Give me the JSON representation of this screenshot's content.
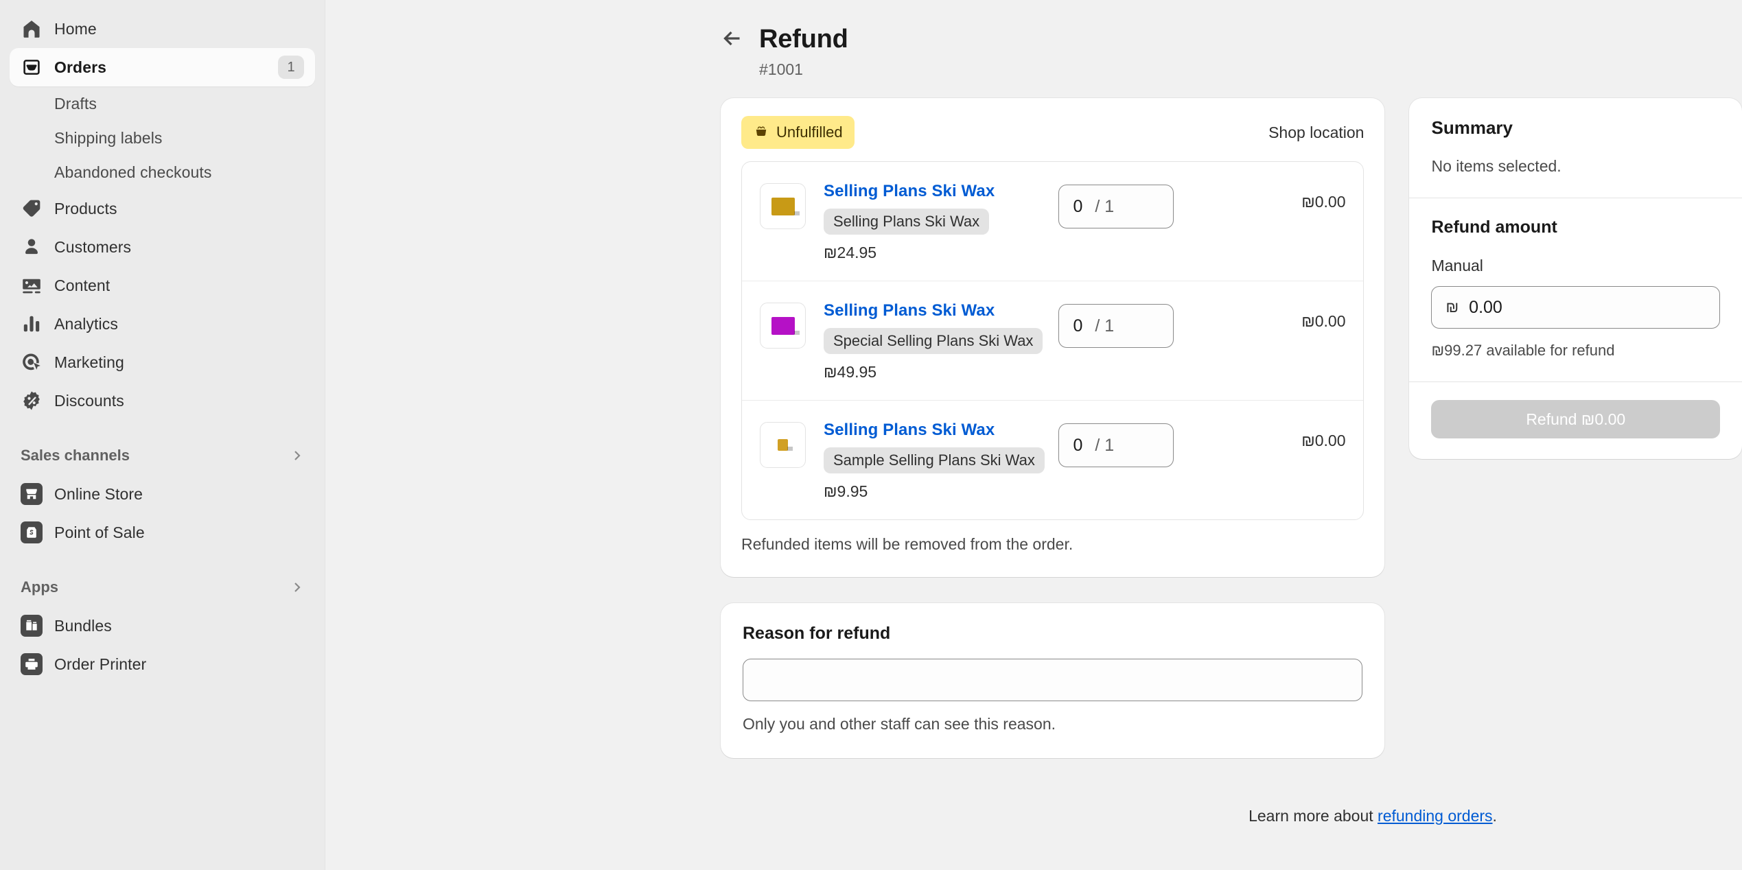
{
  "sidebar": {
    "primary": [
      {
        "label": "Home",
        "icon": "home-icon",
        "badge": null,
        "active": false
      },
      {
        "label": "Orders",
        "icon": "orders-inbox-icon",
        "badge": "1",
        "active": true
      }
    ],
    "order_subitems": [
      {
        "label": "Drafts"
      },
      {
        "label": "Shipping labels"
      },
      {
        "label": "Abandoned checkouts"
      }
    ],
    "secondary": [
      {
        "label": "Products",
        "icon": "tag-icon"
      },
      {
        "label": "Customers",
        "icon": "person-icon"
      },
      {
        "label": "Content",
        "icon": "image-icon"
      },
      {
        "label": "Analytics",
        "icon": "bar-chart-icon"
      },
      {
        "label": "Marketing",
        "icon": "target-cursor-icon"
      },
      {
        "label": "Discounts",
        "icon": "discount-badge-icon"
      }
    ],
    "sales_channels": {
      "title": "Sales channels",
      "chevron": "chevron-right-icon",
      "items": [
        {
          "label": "Online Store",
          "icon": "storefront-icon"
        },
        {
          "label": "Point of Sale",
          "icon": "pos-bag-icon"
        }
      ]
    },
    "apps": {
      "title": "Apps",
      "chevron": "chevron-right-icon",
      "items": [
        {
          "label": "Bundles",
          "icon": "bundles-icon"
        },
        {
          "label": "Order Printer",
          "icon": "printer-icon"
        }
      ]
    }
  },
  "header": {
    "back_icon": "arrow-left-icon",
    "title": "Refund",
    "order_number": "#1001"
  },
  "items_card": {
    "status_badge": {
      "label": "Unfulfilled",
      "icon": "unfulfilled-icon",
      "bg": "#ffea8a",
      "fg": "#3d2e00"
    },
    "location": "Shop location",
    "items": [
      {
        "name": "Selling Plans Ski Wax",
        "variant": "Selling Plans Ski Wax",
        "price": "₪24.95",
        "qty": "0",
        "qty_max": "/ 1",
        "total": "₪0.00",
        "swatch_color": "#c89a16",
        "swatch_w": 34,
        "swatch_h": 26
      },
      {
        "name": "Selling Plans Ski Wax",
        "variant": "Special Selling Plans Ski Wax",
        "price": "₪49.95",
        "qty": "0",
        "qty_max": "/ 1",
        "total": "₪0.00",
        "swatch_color": "#b511c6",
        "swatch_w": 34,
        "swatch_h": 26
      },
      {
        "name": "Selling Plans Ski Wax",
        "variant": "Sample Selling Plans Ski Wax",
        "price": "₪9.95",
        "qty": "0",
        "qty_max": "/ 1",
        "total": "₪0.00",
        "swatch_color": "#d1a024",
        "swatch_w": 15,
        "swatch_h": 17
      }
    ],
    "note": "Refunded items will be removed from the order."
  },
  "reason_card": {
    "title": "Reason for refund",
    "value": "",
    "placeholder": "",
    "help": "Only you and other staff can see this reason."
  },
  "summary": {
    "title": "Summary",
    "empty_text": "No items selected.",
    "refund_amount_title": "Refund amount",
    "manual_label": "Manual",
    "currency_symbol": "₪",
    "amount_value": "0.00",
    "available_text": "₪99.27 available for refund",
    "refund_button_label": "Refund ₪0.00"
  },
  "footer": {
    "prefix": "Learn more about ",
    "link": "refunding orders",
    "suffix": "."
  }
}
